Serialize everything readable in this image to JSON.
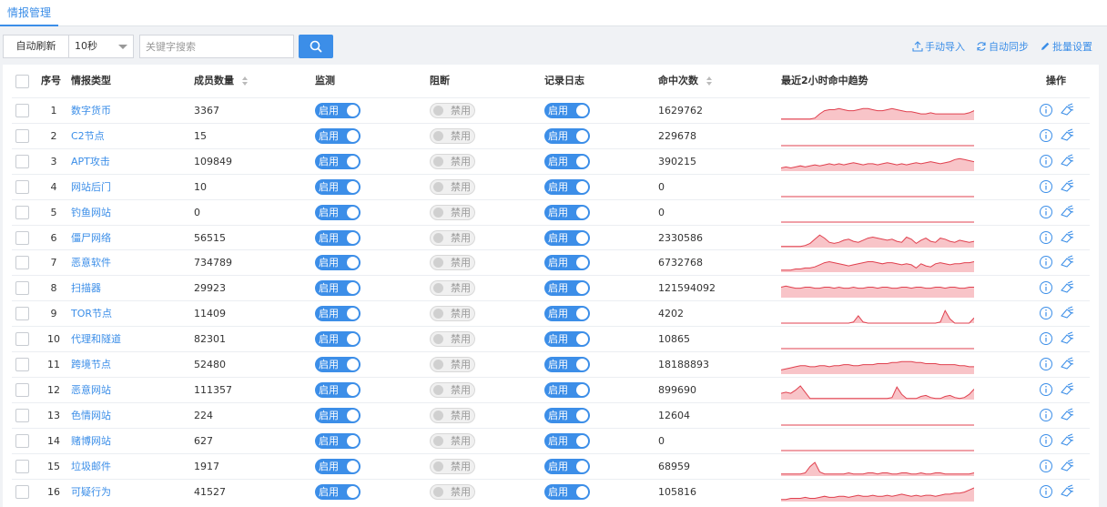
{
  "header": {
    "tab_label": "情报管理"
  },
  "toolbar": {
    "auto_refresh_label": "自动刷新",
    "refresh_interval": "10秒",
    "search_placeholder": "关键字搜索",
    "manual_import_label": "手动导入",
    "auto_sync_label": "自动同步",
    "batch_settings_label": "批量设置"
  },
  "table": {
    "columns": {
      "index": "序号",
      "type": "情报类型",
      "members": "成员数量",
      "monitor": "监测",
      "block": "阻断",
      "log": "记录日志",
      "hits": "命中次数",
      "trend": "最近2小时命中趋势",
      "ops": "操作"
    },
    "enabled_label": "启用",
    "disabled_label": "禁用",
    "rows": [
      {
        "index": "1",
        "type": "数字货币",
        "members": "3367",
        "hits": "1629762",
        "trend": [
          1,
          1,
          1,
          1,
          1,
          1,
          1,
          2,
          6,
          9,
          10,
          10,
          11,
          10,
          9,
          9,
          10,
          11,
          11,
          10,
          9,
          9,
          10,
          11,
          10,
          9,
          8,
          8,
          7,
          6,
          6,
          7,
          6,
          6,
          6,
          6,
          6,
          6,
          6,
          7,
          9
        ]
      },
      {
        "index": "2",
        "type": "C2节点",
        "members": "15",
        "hits": "229678",
        "trend": [
          0,
          0,
          0,
          0,
          0,
          0,
          0,
          0,
          0,
          0,
          0,
          0,
          0,
          0,
          0,
          0,
          0,
          0,
          0,
          0,
          0,
          0,
          0,
          0,
          0,
          0,
          0,
          0,
          0,
          0,
          0,
          0,
          0,
          0,
          0,
          0,
          0,
          0,
          0,
          0,
          0
        ]
      },
      {
        "index": "3",
        "type": "APT攻击",
        "members": "109849",
        "hits": "390215",
        "trend": [
          3,
          4,
          3,
          4,
          5,
          4,
          5,
          6,
          5,
          6,
          7,
          6,
          7,
          6,
          7,
          8,
          7,
          6,
          7,
          7,
          6,
          7,
          8,
          7,
          6,
          7,
          6,
          7,
          8,
          7,
          8,
          9,
          8,
          7,
          8,
          9,
          11,
          12,
          11,
          10,
          9
        ]
      },
      {
        "index": "4",
        "type": "网站后门",
        "members": "10",
        "hits": "0",
        "trend": [
          0,
          0,
          0,
          0,
          0,
          0,
          0,
          0,
          0,
          0,
          0,
          0,
          0,
          0,
          0,
          0,
          0,
          0,
          0,
          0,
          0,
          0,
          0,
          0,
          0,
          0,
          0,
          0,
          0,
          0,
          0,
          0,
          0,
          0,
          0,
          0,
          0,
          0,
          0,
          0,
          0
        ]
      },
      {
        "index": "5",
        "type": "钓鱼网站",
        "members": "0",
        "hits": "0",
        "trend": [
          0,
          0,
          0,
          0,
          0,
          0,
          0,
          0,
          0,
          0,
          0,
          0,
          0,
          0,
          0,
          0,
          0,
          0,
          0,
          0,
          0,
          0,
          0,
          0,
          0,
          0,
          0,
          0,
          0,
          0,
          0,
          0,
          0,
          0,
          0,
          0,
          0,
          0,
          0,
          0,
          0
        ]
      },
      {
        "index": "6",
        "type": "僵尸网络",
        "members": "56515",
        "hits": "2330586",
        "trend": [
          1,
          1,
          1,
          1,
          1,
          2,
          4,
          8,
          12,
          9,
          5,
          4,
          5,
          7,
          8,
          6,
          5,
          7,
          9,
          10,
          9,
          8,
          7,
          8,
          6,
          5,
          10,
          8,
          4,
          7,
          9,
          6,
          5,
          9,
          8,
          6,
          5,
          7,
          6,
          5,
          6
        ]
      },
      {
        "index": "7",
        "type": "恶意软件",
        "members": "734789",
        "hits": "6732768",
        "trend": [
          2,
          2,
          2,
          3,
          3,
          4,
          4,
          5,
          7,
          9,
          10,
          9,
          8,
          7,
          6,
          7,
          8,
          9,
          10,
          10,
          9,
          8,
          9,
          9,
          8,
          7,
          8,
          7,
          4,
          8,
          6,
          5,
          8,
          9,
          8,
          7,
          8,
          8,
          9,
          9,
          10
        ]
      },
      {
        "index": "8",
        "type": "扫描器",
        "members": "29923",
        "hits": "121594092",
        "trend": [
          10,
          11,
          10,
          9,
          9,
          10,
          10,
          9,
          9,
          10,
          10,
          9,
          10,
          9,
          9,
          10,
          9,
          9,
          10,
          10,
          9,
          10,
          10,
          9,
          9,
          10,
          10,
          9,
          10,
          10,
          9,
          9,
          10,
          10,
          9,
          10,
          10,
          9,
          9,
          10,
          10
        ]
      },
      {
        "index": "9",
        "type": "TOR节点",
        "members": "11409",
        "hits": "4202",
        "trend": [
          0,
          0,
          0,
          0,
          0,
          0,
          0,
          0,
          0,
          0,
          0,
          0,
          0,
          0,
          0,
          1,
          7,
          1,
          0,
          0,
          0,
          0,
          0,
          0,
          0,
          0,
          0,
          0,
          0,
          0,
          0,
          0,
          0,
          1,
          12,
          4,
          0,
          0,
          0,
          0,
          5
        ]
      },
      {
        "index": "10",
        "type": "代理和隧道",
        "members": "82301",
        "hits": "10865",
        "trend": [
          0,
          0,
          0,
          0,
          0,
          0,
          0,
          0,
          0,
          0,
          0,
          0,
          0,
          0,
          0,
          0,
          0,
          0,
          0,
          0,
          0,
          0,
          0,
          0,
          0,
          0,
          0,
          0,
          0,
          0,
          0,
          0,
          0,
          0,
          0,
          0,
          0,
          0,
          0,
          0,
          0
        ]
      },
      {
        "index": "11",
        "type": "跨境节点",
        "members": "52480",
        "hits": "18188893",
        "trend": [
          4,
          5,
          6,
          7,
          8,
          8,
          7,
          7,
          8,
          8,
          7,
          8,
          8,
          9,
          9,
          8,
          8,
          9,
          9,
          9,
          10,
          10,
          10,
          11,
          11,
          12,
          12,
          12,
          11,
          11,
          10,
          10,
          10,
          9,
          9,
          9,
          9,
          8,
          8,
          7,
          7
        ]
      },
      {
        "index": "12",
        "type": "恶意网站",
        "members": "111357",
        "hits": "899690",
        "trend": [
          6,
          7,
          6,
          9,
          13,
          7,
          1,
          1,
          1,
          1,
          1,
          1,
          1,
          1,
          1,
          1,
          1,
          1,
          1,
          1,
          1,
          1,
          1,
          2,
          12,
          5,
          1,
          1,
          1,
          3,
          4,
          2,
          1,
          1,
          3,
          4,
          2,
          1,
          2,
          5,
          10
        ]
      },
      {
        "index": "13",
        "type": "色情网站",
        "members": "224",
        "hits": "12604",
        "trend": [
          0,
          0,
          0,
          0,
          0,
          0,
          0,
          0,
          0,
          0,
          0,
          0,
          0,
          0,
          0,
          0,
          0,
          0,
          0,
          0,
          0,
          0,
          0,
          0,
          0,
          0,
          0,
          0,
          0,
          0,
          0,
          0,
          0,
          0,
          0,
          0,
          0,
          0,
          0,
          0,
          0
        ]
      },
      {
        "index": "14",
        "type": "赌博网站",
        "members": "627",
        "hits": "0",
        "trend": [
          0,
          0,
          0,
          0,
          0,
          0,
          0,
          0,
          0,
          0,
          0,
          0,
          0,
          0,
          0,
          0,
          0,
          0,
          0,
          0,
          0,
          0,
          0,
          0,
          0,
          0,
          0,
          0,
          0,
          0,
          0,
          0,
          0,
          0,
          0,
          0,
          0,
          0,
          0,
          0,
          0
        ]
      },
      {
        "index": "15",
        "type": "垃圾邮件",
        "members": "1917",
        "hits": "68959",
        "trend": [
          2,
          2,
          2,
          2,
          2,
          3,
          9,
          13,
          4,
          2,
          2,
          2,
          2,
          2,
          3,
          2,
          2,
          2,
          3,
          3,
          2,
          3,
          3,
          2,
          2,
          3,
          3,
          2,
          2,
          3,
          2,
          2,
          3,
          3,
          2,
          2,
          2,
          2,
          2,
          2,
          3
        ]
      },
      {
        "index": "16",
        "type": "可疑行为",
        "members": "41527",
        "hits": "105816",
        "trend": [
          2,
          2,
          3,
          3,
          3,
          4,
          3,
          3,
          4,
          5,
          4,
          4,
          5,
          5,
          4,
          5,
          6,
          5,
          5,
          6,
          5,
          5,
          6,
          5,
          6,
          7,
          6,
          5,
          6,
          5,
          6,
          6,
          5,
          6,
          7,
          7,
          8,
          8,
          9,
          11,
          13
        ]
      }
    ]
  }
}
